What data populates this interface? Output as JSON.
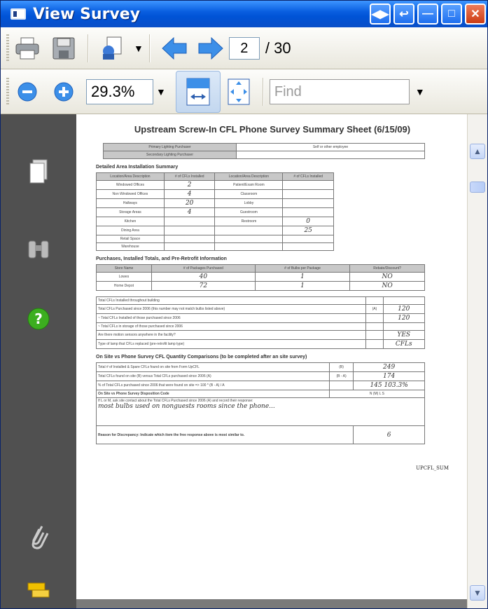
{
  "window": {
    "title": "View Survey"
  },
  "toolbar": {
    "page_current": "2",
    "page_total": "/ 30",
    "zoom": "29.3%",
    "find_placeholder": "Find"
  },
  "icons": {
    "print": "printer-icon",
    "save": "floppy-icon",
    "attach": "attachment-icon",
    "prev": "left-arrow-icon",
    "next": "right-arrow-icon",
    "zoom_out": "zoom-out-icon",
    "zoom_in": "zoom-in-icon",
    "fit_width": "fit-width-icon",
    "fit_page": "fit-page-icon",
    "pages": "pages-icon",
    "search": "binoculars-icon",
    "help": "help-icon",
    "paperclip": "paperclip-icon",
    "layers": "layers-icon"
  },
  "colors": {
    "title_bar": "#0053d6",
    "side_panel": "#505050",
    "help_green": "#3cae1f",
    "nav_blue": "#3c8fe8"
  },
  "document": {
    "title": "Upstream Screw-In CFL Phone Survey Summary Sheet (6/15/09)",
    "purchaser_rows": [
      {
        "label": "Primary Lighting Purchaser",
        "value": "Self or other employee"
      },
      {
        "label": "Secondary Lighting Purchaser",
        "value": ""
      }
    ],
    "detail_heading": "Detailed Area Installation Summary",
    "detail_headers": [
      "Location/Area Description",
      "# of CFLs Installed",
      "Location/Area Description",
      "# of CFLs Installed"
    ],
    "detail_rows": [
      [
        "Windowed Offices",
        "2",
        "Patient/Exam Room",
        ""
      ],
      [
        "Non Windowed Offices",
        "4",
        "Classroom",
        ""
      ],
      [
        "Hallways",
        "20",
        "Lobby",
        ""
      ],
      [
        "Storage Areas",
        "4",
        "Guestroom",
        ""
      ],
      [
        "Kitchen",
        "",
        "Restroom",
        "0"
      ],
      [
        "Dining Area",
        "",
        "",
        "25"
      ],
      [
        "Retail Space",
        "",
        "",
        ""
      ],
      [
        "Warehouse",
        "",
        "",
        ""
      ]
    ],
    "purchase_heading": "Purchases, Installed Totals, and Pre-Retrofit Information",
    "purchase_headers": [
      "Store Name",
      "# of Packages Purchased",
      "# of Bulbs per Package",
      "Rebate/Discount?"
    ],
    "purchase_rows": [
      [
        "Lowes",
        "40",
        "1",
        "NO"
      ],
      [
        "Home Depot",
        "72",
        "1",
        "NO"
      ]
    ],
    "totals_rows": [
      {
        "label": "Total CFLs Installed throughout building",
        "code": "",
        "value": ""
      },
      {
        "label": "Total CFLs Purchased since 2006 (this number may not match bulbs listed above)",
        "code": "(A)",
        "value": "120"
      },
      {
        "label": "~ Total CFLs Installed of those purchased since 2006",
        "code": "",
        "value": "120"
      },
      {
        "label": "~ Total CFLs in storage of those purchased since 2006",
        "code": "",
        "value": ""
      },
      {
        "label": "Are there motion sensors anywhere in the facility?",
        "code": "",
        "value": "YES"
      },
      {
        "label": "Type of lamp that CFLs replaced (pre-retrofit lamp type)",
        "code": "",
        "value": "CFLs"
      }
    ],
    "compare_heading": "On Site vs Phone Survey CFL Quantity Comparisons (to be completed after an site survey)",
    "compare_rows": [
      {
        "label": "Total # of Installed & Spare CFLs found on site from Form UpCFL",
        "code": "(B)",
        "value": "249"
      },
      {
        "label": "Total CFLs found on site (B) versus Total CFLs purchased since 2006 (A)",
        "code": "(B - A)",
        "value": "174"
      },
      {
        "label": "% of Total CFLs purchased since 2006 that were found on site => 100 * (B - A) / A",
        "code": "",
        "value": "145  103.3%"
      }
    ],
    "disposition_heading": "On Site vs Phone Survey Disposition Code",
    "disposition_options": "N  (M)  L  S",
    "contact_note": "If L or M, ask site contact about the Total CFLs Purchased since 2006 (A) and record their response:",
    "contact_response": "most bulbs used on nonguests rooms since the phone...",
    "discrepancy_heading": "Reason for Discrepancy: Indicate which item the free response above is most similar to.",
    "discrepancy_value": "6",
    "footer_code": "UPCFL_SUM"
  }
}
